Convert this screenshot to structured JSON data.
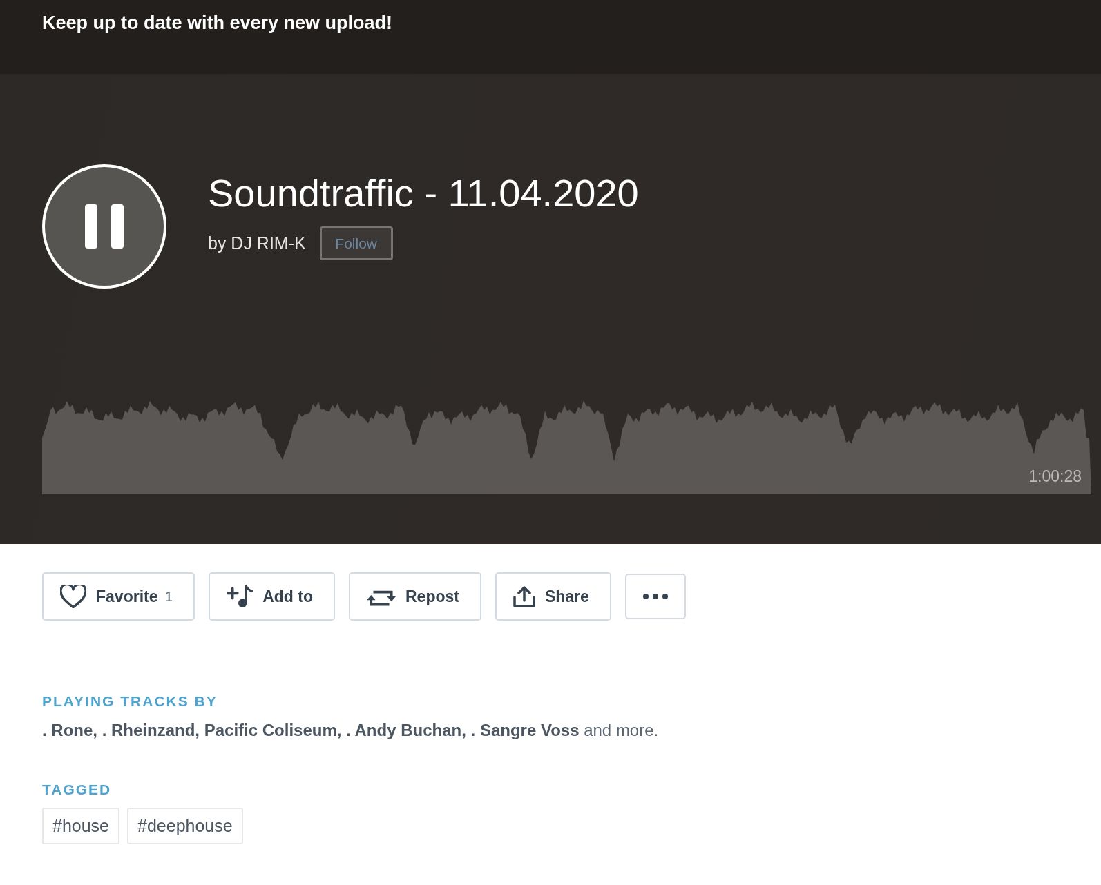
{
  "banner": {
    "text": "Keep up to date with every new upload!"
  },
  "player": {
    "playing": true,
    "title": "Soundtraffic - 11.04.2020",
    "byline": "by DJ RIM-K",
    "follow_label": "Follow",
    "duration": "1:00:28"
  },
  "actions": [
    {
      "kind": "favorite",
      "label": "Favorite",
      "count": "1"
    },
    {
      "kind": "add",
      "label": "Add to"
    },
    {
      "kind": "repost",
      "label": "Repost"
    },
    {
      "kind": "share",
      "label": "Share"
    },
    {
      "kind": "more"
    }
  ],
  "playing_tracks": {
    "heading": "PLAYING TRACKS BY",
    "text": "**. Rone, . Rheinzand, Pacific Coliseum, . Andy Buchan, . Sangre Voss** and more."
  },
  "tagged": {
    "heading": "TAGGED",
    "tags": [
      "#house",
      "#deephouse"
    ]
  }
}
